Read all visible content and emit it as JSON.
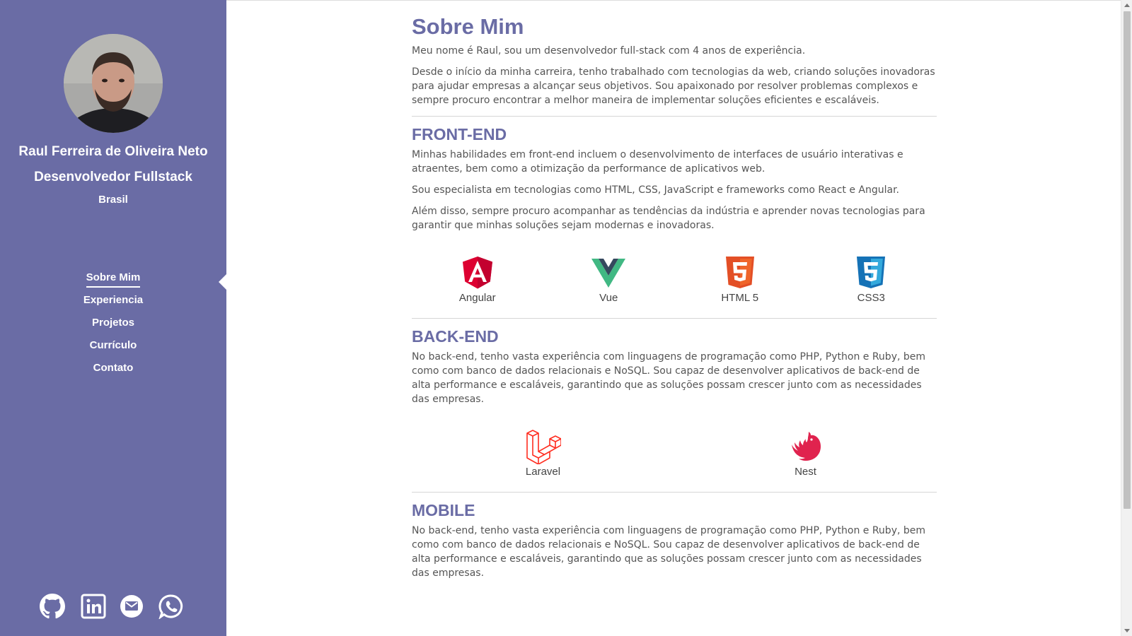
{
  "profile": {
    "name": "Raul Ferreira de Oliveira Neto",
    "role": "Desenvolvedor Fullstack",
    "country": "Brasil"
  },
  "nav": [
    {
      "label": "Sobre Mim",
      "active": true
    },
    {
      "label": "Experiencia",
      "active": false
    },
    {
      "label": "Projetos",
      "active": false
    },
    {
      "label": "Currículo",
      "active": false
    },
    {
      "label": "Contato",
      "active": false
    }
  ],
  "socials": [
    "github-icon",
    "linkedin-icon",
    "email-icon",
    "whatsapp-icon"
  ],
  "about": {
    "title": "Sobre Mim",
    "p1": "Meu nome é Raul, sou um desenvolvedor full-stack com 4 anos de experiência.",
    "p2": "Desde o início da minha carreira, tenho trabalhado com tecnologias da web, criando soluções inovadoras para ajudar empresas a alcançar seus objetivos. Sou apaixonado por resolver problemas complexos e sempre procuro encontrar a melhor maneira de implementar soluções eficientes e escaláveis."
  },
  "frontend": {
    "title": "FRONT-END",
    "p1": "Minhas habilidades em front-end incluem o desenvolvimento de interfaces de usuário interativas e atraentes, bem como a otimização da performance de aplicativos web.",
    "p2": "Sou especialista em tecnologias como HTML, CSS, JavaScript e frameworks como React e Angular.",
    "p3": "Além disso, sempre procuro acompanhar as tendências da indústria e aprender novas tecnologias para garantir que minhas soluções sejam modernas e inovadoras.",
    "techs": [
      "Angular",
      "Vue",
      "HTML 5",
      "CSS3"
    ]
  },
  "backend": {
    "title": "BACK-END",
    "p1": "No back-end, tenho vasta experiência com linguagens de programação como PHP, Python e Ruby, bem como com banco de dados relacionais e NoSQL. Sou capaz de desenvolver aplicativos de back-end de alta performance e escaláveis, garantindo que as soluções possam crescer junto com as necessidades das empresas.",
    "techs": [
      "Laravel",
      "Nest"
    ]
  },
  "mobile": {
    "title": "MOBILE",
    "p1": "No back-end, tenho vasta experiência com linguagens de programação como PHP, Python e Ruby, bem como com banco de dados relacionais e NoSQL. Sou capaz de desenvolver aplicativos de back-end de alta performance e escaláveis, garantindo que as soluções possam crescer junto com as necessidades das empresas."
  },
  "colors": {
    "sidebar": "#6a6ca5",
    "accent": "#6a6ca5",
    "angular": "#dd0031",
    "vue_green": "#41b883",
    "vue_dark": "#35495e",
    "html5": "#e34f26",
    "css3": "#1572b6",
    "laravel": "#ff2d20",
    "nest": "#e0234e"
  }
}
